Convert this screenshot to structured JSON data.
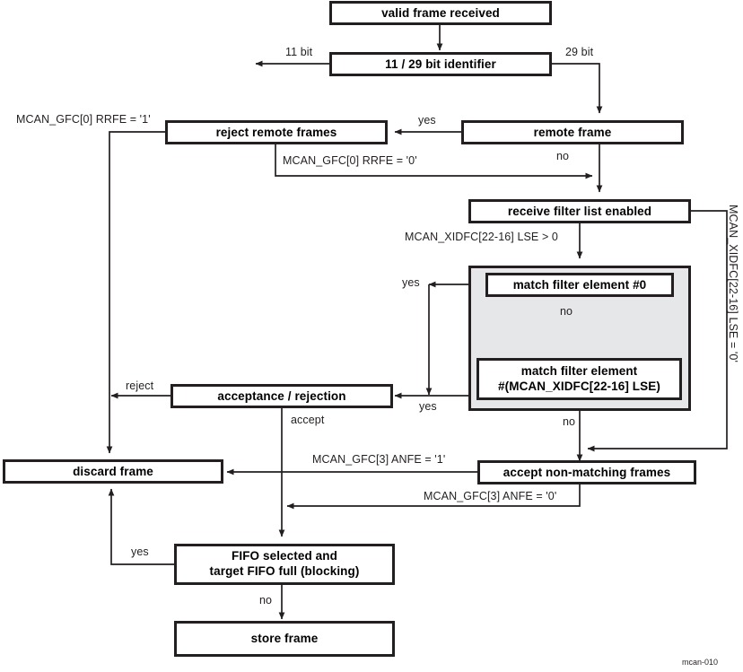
{
  "figure": {
    "id_label": "mcan-010",
    "colors": {
      "stroke": "#231f20",
      "group_fill": "#e6e7e8",
      "node_fill": "#ffffff",
      "background": "#ffffff"
    }
  },
  "nodes": {
    "valid_frame": "valid frame received",
    "identifier": "11 / 29 bit identifier",
    "remote_frame": "remote frame",
    "reject_remote": "reject remote frames",
    "receive_filter": "receive filter list enabled",
    "match_first": "match filter element #0",
    "match_last_line1": "match filter element",
    "match_last_line2": "#(MCAN_XIDFC[22-16] LSE)",
    "acceptance": "acceptance / rejection",
    "accept_nonmatching": "accept non-matching frames",
    "discard": "discard frame",
    "fifo_line1": "FIFO selected and",
    "fifo_line2": "target FIFO full (blocking)",
    "store": "store frame"
  },
  "edge_labels": {
    "bit11": "11 bit",
    "bit29": "29 bit",
    "remote_yes": "yes",
    "rrfe_one": "MCAN_GFC[0] RRFE = '1'",
    "rrfe_zero": "MCAN_GFC[0] RRFE = '0'",
    "remote_no": "no",
    "lse_gt_zero": "MCAN_XIDFC[22-16] LSE > 0",
    "lse_eq_zero": "MCAN_XIDFC[22-16] LSE = '0'",
    "match_yes_top": "yes",
    "match_no_mid": "no",
    "match_yes_bottom": "yes",
    "filter_no": "no",
    "reject": "reject",
    "accept": "accept",
    "anfe_one": "MCAN_GFC[3] ANFE = '1'",
    "anfe_zero": "MCAN_GFC[3] ANFE = '0'",
    "fifo_yes": "yes",
    "fifo_no": "no"
  }
}
